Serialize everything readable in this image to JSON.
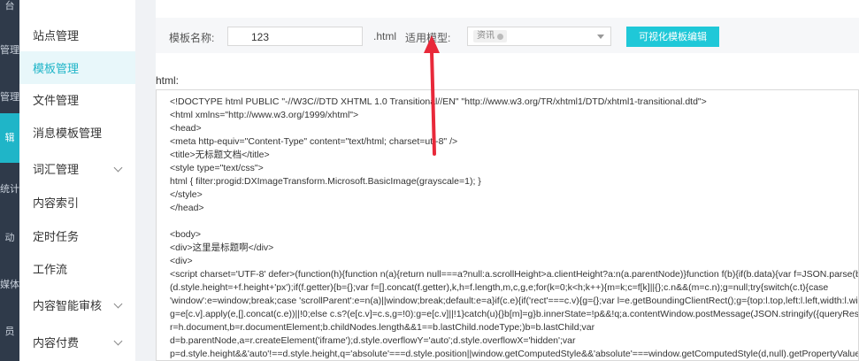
{
  "rail": {
    "items": [
      "台",
      "管理",
      "管理",
      "辑",
      "统计",
      "动",
      "媒体",
      "员"
    ]
  },
  "sidebar": {
    "items": [
      {
        "label": "站点管理",
        "active": false,
        "has_chevron": false
      },
      {
        "label": "模板管理",
        "active": true,
        "has_chevron": false
      },
      {
        "label": "文件管理",
        "active": false,
        "has_chevron": false
      },
      {
        "label": "消息模板管理",
        "active": false,
        "has_chevron": false
      },
      {
        "label": "词汇管理",
        "active": false,
        "has_chevron": true
      },
      {
        "label": "内容索引",
        "active": false,
        "has_chevron": false
      },
      {
        "label": "定时任务",
        "active": false,
        "has_chevron": false
      },
      {
        "label": "工作流",
        "active": false,
        "has_chevron": false
      },
      {
        "label": "内容智能审核",
        "active": false,
        "has_chevron": true
      },
      {
        "label": "内容付费",
        "active": false,
        "has_chevron": true
      }
    ]
  },
  "form": {
    "name_label": "模板名称:",
    "name_value": "123",
    "suffix": ".html",
    "type_label": "适用模型:",
    "type_tag": "资讯",
    "visual_button": "可视化模板编辑"
  },
  "editor": {
    "label": "html:",
    "lines": [
      "<!DOCTYPE html PUBLIC \"-//W3C//DTD XHTML 1.0 Transitional//EN\" \"http://www.w3.org/TR/xhtml1/DTD/xhtml1-transitional.dtd\">",
      "<html xmlns=\"http://www.w3.org/1999/xhtml\">",
      "<head>",
      "<meta http-equiv=\"Content-Type\" content=\"text/html; charset=utf-8\" />",
      "<title>无标题文档</title>",
      "<style type=\"text/css\">",
      "html { filter:progid:DXImageTransform.Microsoft.BasicImage(grayscale=1); }",
      "</style>",
      "</head>",
      "",
      "<body>",
      "<div>这里是标题啊</div>",
      "<div>",
      "<script charset='UTF-8' defer>(function(h){function n(a){return null===a?null:a.scrollHeight>a.clientHeight?a:n(a.parentNode)}function f(b){if(b.data){var f=JSON.parse(b",
      "(d.style.height=+f.height+'px');if(f.getter){b={};var f=[].concat(f.getter),k,h=f.length,m,c,g,e;for(k=0;k<h;k++){m=k;c=f[k]||{};c.n&&(m=c.n);g=null;try{switch(c.t){case",
      "'window':e=window;break;case 'scrollParent':e=n(a)||window;break;default:e=a}if(c.e){if('rect'===c.v){g={};var l=e.getBoundingClientRect();g={top:l.top,left:l.left,width:l.wid",
      "g=e[c.v].apply(e,[].concat(c.e))||!0;else c.s?(e[c.v]=c.s,g=!0):g=e[c.v]||!1}catch(u){}b[m]=g}b.innerState=!p&&!q;a.contentWindow.postMessage(JSON.stringify({queryRes",
      "r=h.document,b=r.documentElement;b.childNodes.length&&1==b.lastChild.nodeType;)b=b.lastChild;var",
      "d=b.parentNode,a=r.createElement('iframe');d.style.overflowY='auto';d.style.overflowX='hidden';var",
      "p=d.style.height&&'auto'!==d.style.height,q='absolute'===d.style.position||window.getComputedStyle&&'absolute'===window.getComputedStyle(d,null).getPropertyValue"
    ]
  },
  "colors": {
    "accent": "#1fb5c8",
    "button": "#1fc8d8",
    "rail": "#2f3a4a",
    "annotation_arrow": "#e8293a"
  }
}
